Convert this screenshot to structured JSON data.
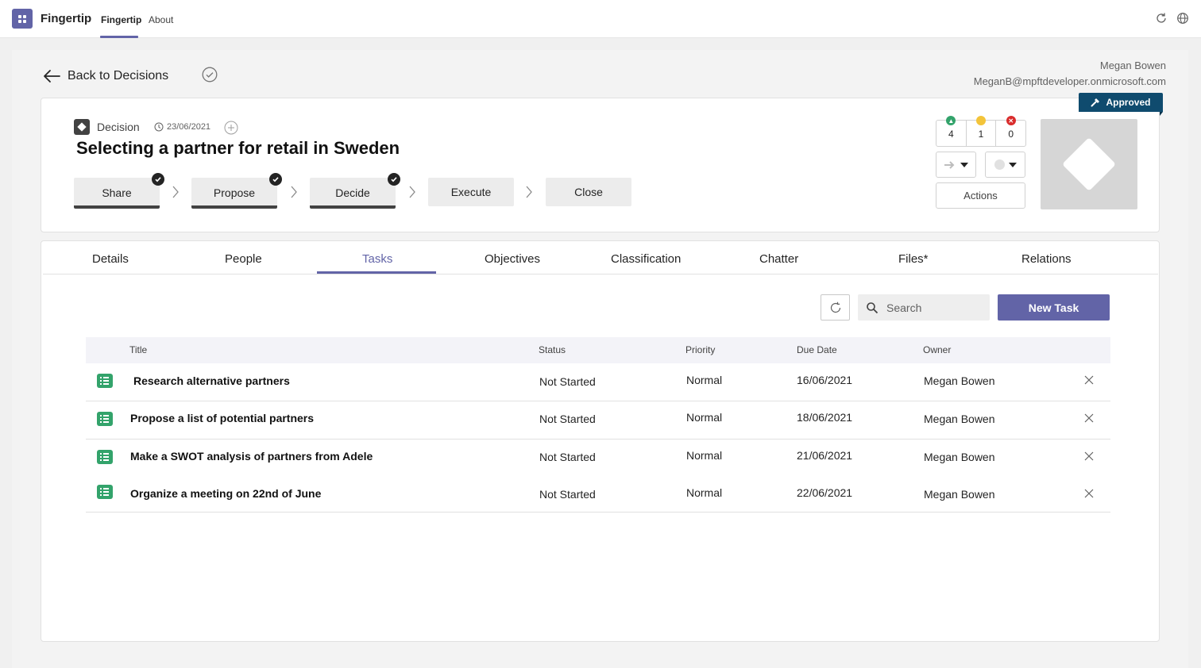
{
  "appbar": {
    "app_name": "Fingertip",
    "tabs": [
      {
        "label": "Fingertip",
        "active": true
      },
      {
        "label": "About",
        "active": false
      }
    ],
    "icons": [
      "refresh-icon",
      "globe-icon"
    ],
    "accent": "#6264a7"
  },
  "nav": {
    "back_label": "Back to Decisions"
  },
  "user": {
    "name": "Megan Bowen",
    "email": "MeganB@mpftdeveloper.onmicrosoft.com"
  },
  "decision": {
    "type_label": "Decision",
    "date": "23/06/2021",
    "title": "Selecting a partner for retail in Sweden",
    "status_badge": "Approved",
    "status_color": "#0f4b6e",
    "stages": [
      {
        "label": "Share",
        "completed": true
      },
      {
        "label": "Propose",
        "completed": true
      },
      {
        "label": "Decide",
        "completed": true
      },
      {
        "label": "Execute",
        "completed": false
      },
      {
        "label": "Close",
        "completed": false
      }
    ],
    "votes": {
      "positive": "4",
      "neutral": "1",
      "negative": "0"
    },
    "actions_label": "Actions"
  },
  "tabs": [
    {
      "label": "Details",
      "active": false
    },
    {
      "label": "People",
      "active": false
    },
    {
      "label": "Tasks",
      "active": true
    },
    {
      "label": "Objectives",
      "active": false
    },
    {
      "label": "Classification",
      "active": false
    },
    {
      "label": "Chatter",
      "active": false
    },
    {
      "label": "Files*",
      "active": false
    },
    {
      "label": "Relations",
      "active": false
    }
  ],
  "toolbar": {
    "search_placeholder": "Search",
    "new_task_label": "New Task"
  },
  "table": {
    "columns": [
      "Title",
      "Status",
      "Priority",
      "Due Date",
      "Owner"
    ],
    "rows": [
      {
        "title": "Research alternative partners",
        "status": "Not Started",
        "priority": "Normal",
        "due": "16/06/2021",
        "owner": "Megan Bowen"
      },
      {
        "title": "Propose a list of potential partners",
        "status": "Not Started",
        "priority": "Normal",
        "due": "18/06/2021",
        "owner": "Megan Bowen"
      },
      {
        "title": "Make a SWOT analysis of partners from Adele",
        "status": "Not Started",
        "priority": "Normal",
        "due": "21/06/2021",
        "owner": "Megan Bowen"
      },
      {
        "title": "Organize a meeting on 22nd of June",
        "status": "Not Started",
        "priority": "Normal",
        "due": "22/06/2021",
        "owner": "Megan Bowen"
      }
    ]
  }
}
